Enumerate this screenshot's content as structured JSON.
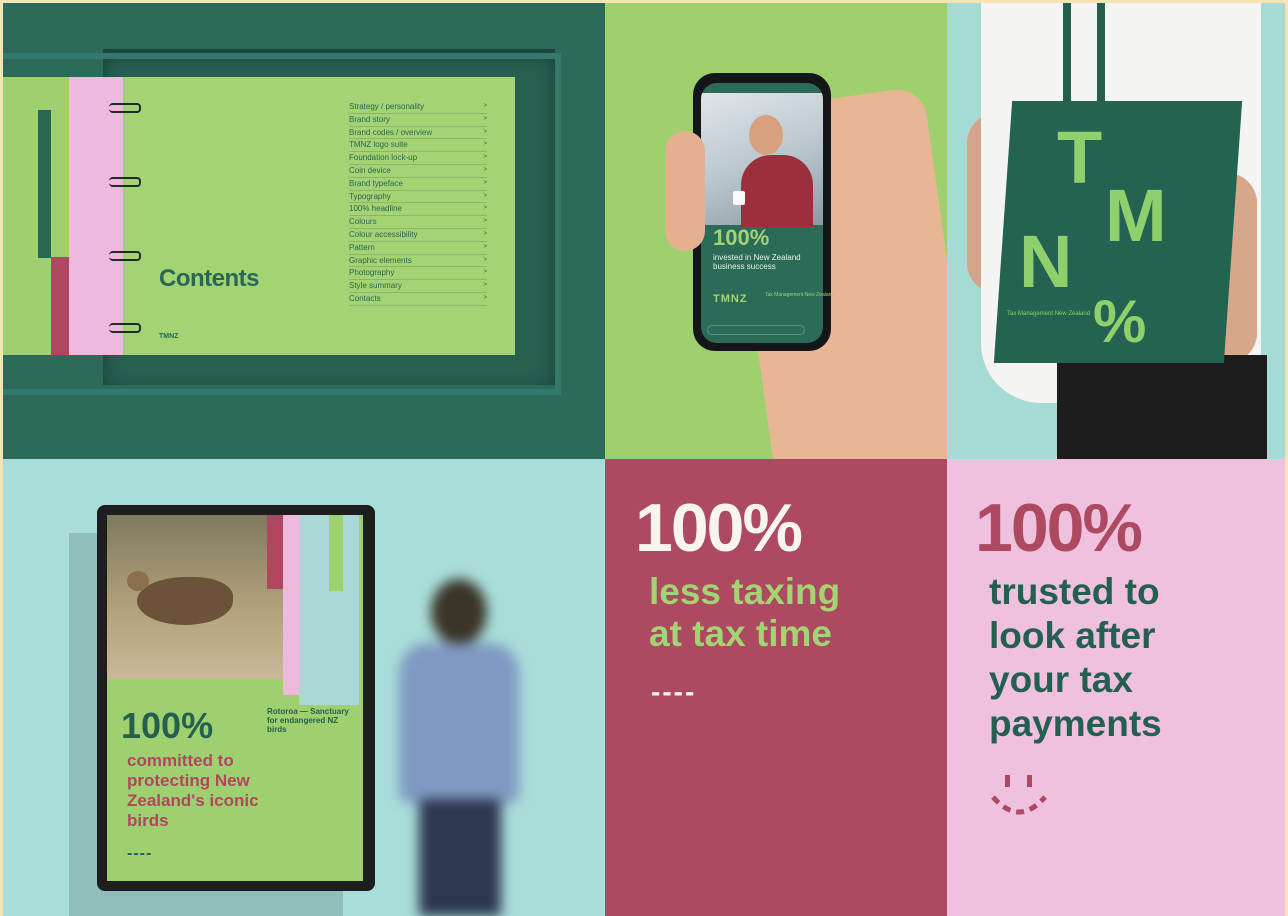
{
  "book": {
    "title": "Contents",
    "logo": "TMNZ",
    "toc": [
      "Strategy / personality",
      "Brand story",
      "Brand codes / overview",
      "TMNZ logo suite",
      "Foundation lock-up",
      "Coin device",
      "Brand typeface",
      "Typography",
      "100% headline",
      "Colours",
      "Colour accessibility",
      "Pattern",
      "Graphic elements",
      "Photography",
      "Style summary",
      "Contacts"
    ]
  },
  "phone": {
    "headline": "100%",
    "text": "invested in New Zealand business success",
    "logo": "TMNZ",
    "logo_sub": "Tax Management New Zealand"
  },
  "bag": {
    "letters": [
      "T",
      "M",
      "N",
      "%"
    ],
    "small": "Tax Management New Zealand"
  },
  "poster": {
    "headline": "100%",
    "text": "committed to protecting New Zealand's iconic birds",
    "caption": "Rotoroa — Sanctuary for endangered NZ birds",
    "dashes": "----"
  },
  "tile_red": {
    "headline": "100%",
    "text_line1": "less taxing",
    "text_line2": "at tax time",
    "dashes": "----"
  },
  "tile_pink": {
    "headline": "100%",
    "lines": [
      "trusted to",
      "look after",
      "your tax",
      "payments"
    ]
  },
  "colors": {
    "dark_green": "#245f50",
    "lime": "#a4d374",
    "pink": "#efc1df",
    "raspberry": "#ad4960",
    "aqua": "#a9ddda"
  }
}
